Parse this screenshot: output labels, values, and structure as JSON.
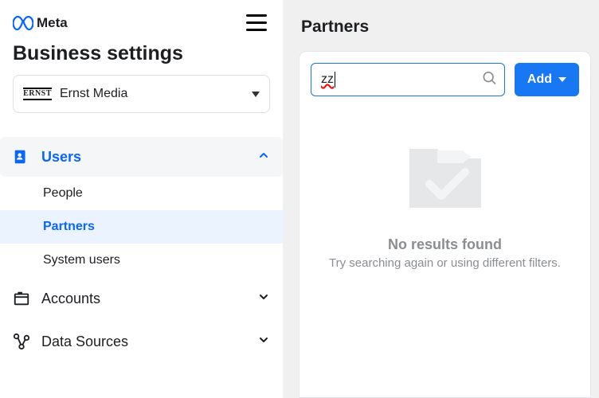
{
  "brand": "Meta",
  "page_title": "Business settings",
  "account": {
    "name": "Ernst Media",
    "logo_text": "ERNST"
  },
  "sidebar": {
    "section_users": "Users",
    "sub": {
      "people": "People",
      "partners": "Partners",
      "system_users": "System users"
    },
    "accounts": "Accounts",
    "data_sources": "Data Sources"
  },
  "main": {
    "title": "Partners",
    "search_value": "zz",
    "add_label": "Add",
    "empty_title": "No results found",
    "empty_sub": "Try searching again or using different filters."
  }
}
